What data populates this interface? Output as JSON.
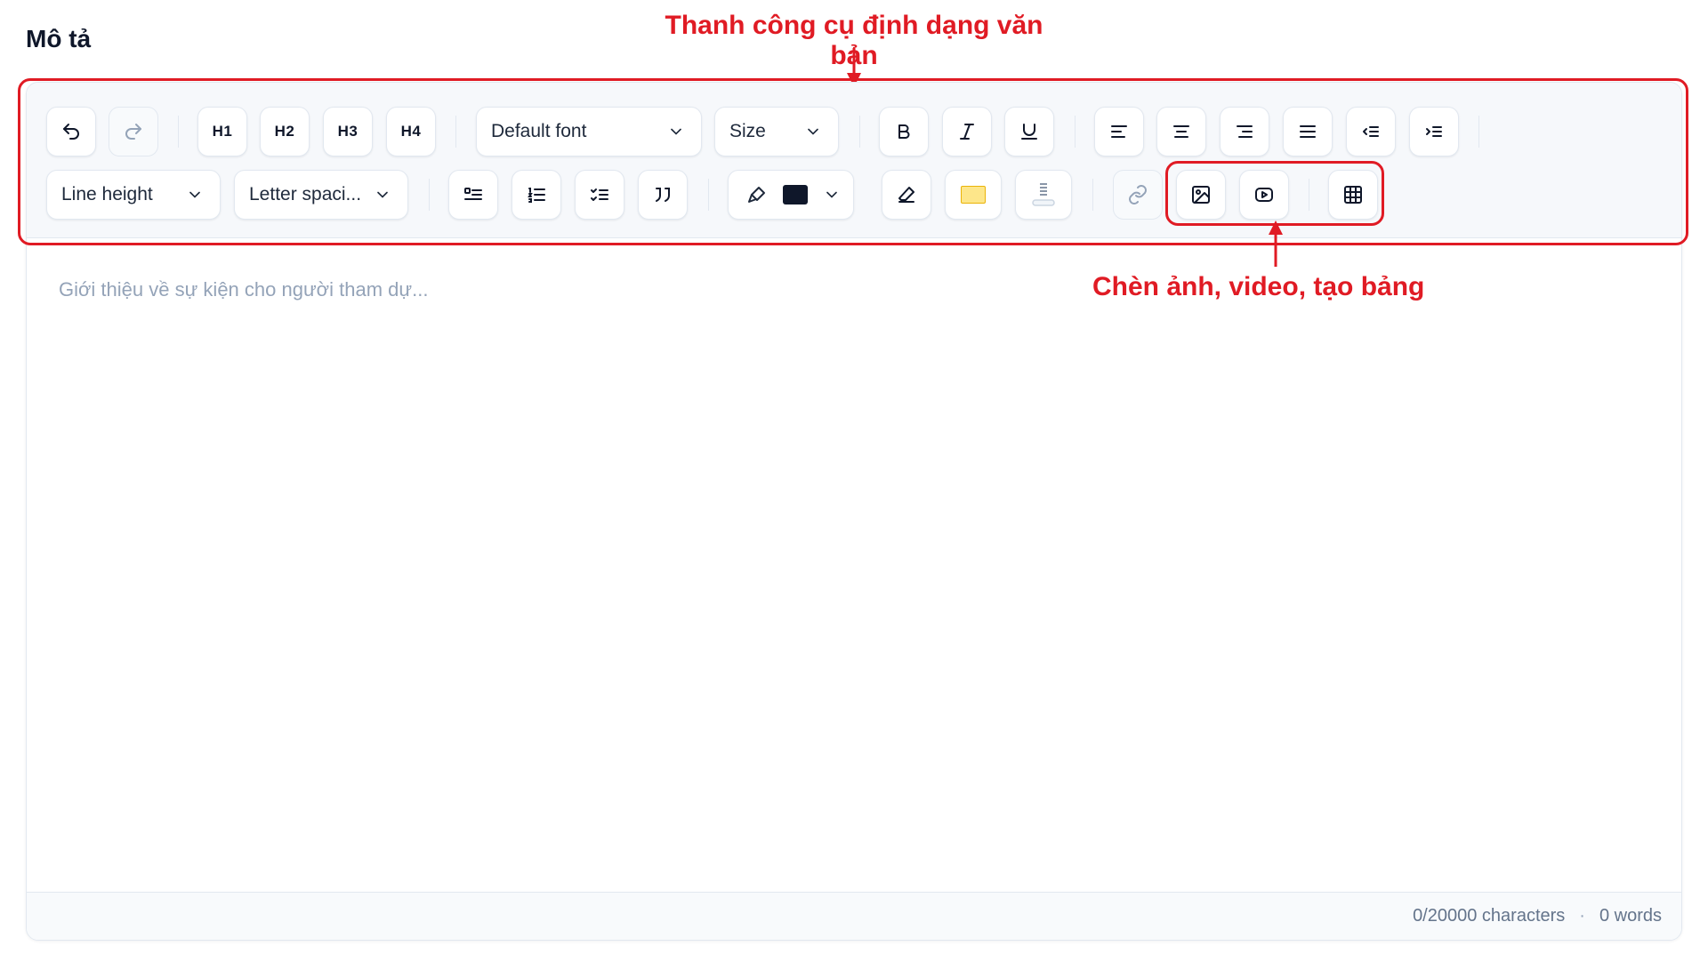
{
  "section_title": "Mô tả",
  "annotations": {
    "toolbar_label": "Thanh công cụ định dạng văn bản",
    "insert_label": "Chèn ảnh, video, tạo bảng"
  },
  "toolbar": {
    "headings": [
      "H1",
      "H2",
      "H3",
      "H4"
    ],
    "font_select": "Default font",
    "size_select": "Size",
    "line_height_select": "Line height",
    "letter_spacing_select": "Letter spaci..."
  },
  "editor": {
    "placeholder": "Giới thiệu về sự kiện cho người tham dự...",
    "character_count": "0/20000 characters",
    "separator": "·",
    "word_count": "0 words"
  },
  "colors": {
    "annotation": "#e01b24",
    "text_color_swatch": "#0f172a",
    "highlight_swatch": "#fde68a"
  },
  "icons": [
    "undo-icon",
    "redo-icon",
    "bold-icon",
    "italic-icon",
    "underline-icon",
    "align-left-icon",
    "align-center-icon",
    "align-right-icon",
    "align-justify-icon",
    "outdent-icon",
    "indent-icon",
    "bullet-list-icon",
    "ordered-list-icon",
    "task-list-icon",
    "quote-icon",
    "paint-brush-icon",
    "eraser-icon",
    "highlight-icon",
    "text-background-icon",
    "link-icon",
    "image-icon",
    "video-icon",
    "table-icon",
    "chevron-down-icon"
  ]
}
